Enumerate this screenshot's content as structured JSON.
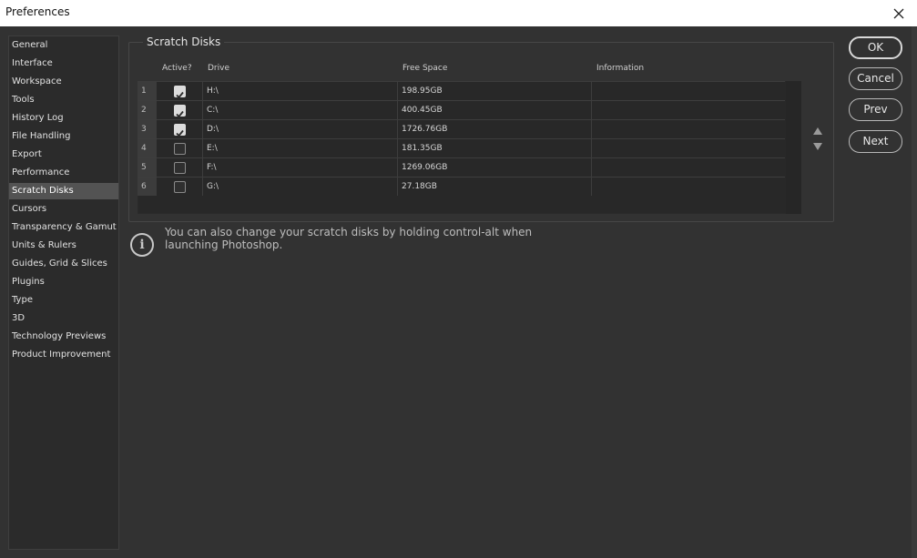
{
  "window": {
    "title": "Preferences",
    "close_icon": "close-icon"
  },
  "sidebar": {
    "items": [
      {
        "label": "General"
      },
      {
        "label": "Interface"
      },
      {
        "label": "Workspace"
      },
      {
        "label": "Tools"
      },
      {
        "label": "History Log"
      },
      {
        "label": "File Handling"
      },
      {
        "label": "Export"
      },
      {
        "label": "Performance"
      },
      {
        "label": "Scratch Disks",
        "selected": true
      },
      {
        "label": "Cursors"
      },
      {
        "label": "Transparency & Gamut"
      },
      {
        "label": "Units & Rulers"
      },
      {
        "label": "Guides, Grid & Slices"
      },
      {
        "label": "Plugins"
      },
      {
        "label": "Type"
      },
      {
        "label": "3D"
      },
      {
        "label": "Technology Previews"
      },
      {
        "label": "Product Improvement"
      }
    ]
  },
  "scratch_disks": {
    "title": "Scratch Disks",
    "columns": {
      "active": "Active?",
      "drive": "Drive",
      "free_space": "Free Space",
      "information": "Information"
    },
    "rows": [
      {
        "num": "1",
        "active": true,
        "drive": "H:\\",
        "free": "198.95GB",
        "info": ""
      },
      {
        "num": "2",
        "active": true,
        "drive": "C:\\",
        "free": "400.45GB",
        "info": ""
      },
      {
        "num": "3",
        "active": true,
        "drive": "D:\\",
        "free": "1726.76GB",
        "info": ""
      },
      {
        "num": "4",
        "active": false,
        "drive": "E:\\",
        "free": "181.35GB",
        "info": ""
      },
      {
        "num": "5",
        "active": false,
        "drive": "F:\\",
        "free": "1269.06GB",
        "info": ""
      },
      {
        "num": "6",
        "active": false,
        "drive": "G:\\",
        "free": "27.18GB",
        "info": ""
      }
    ]
  },
  "info": {
    "icon": "info-icon",
    "text": "You can also change your scratch disks by holding control-alt when launching Photoshop."
  },
  "buttons": {
    "ok": "OK",
    "cancel": "Cancel",
    "prev": "Prev",
    "next": "Next"
  },
  "colors": {
    "background": "#323232",
    "sidebar_selected": "#535353",
    "titlebar": "#ffffff"
  }
}
